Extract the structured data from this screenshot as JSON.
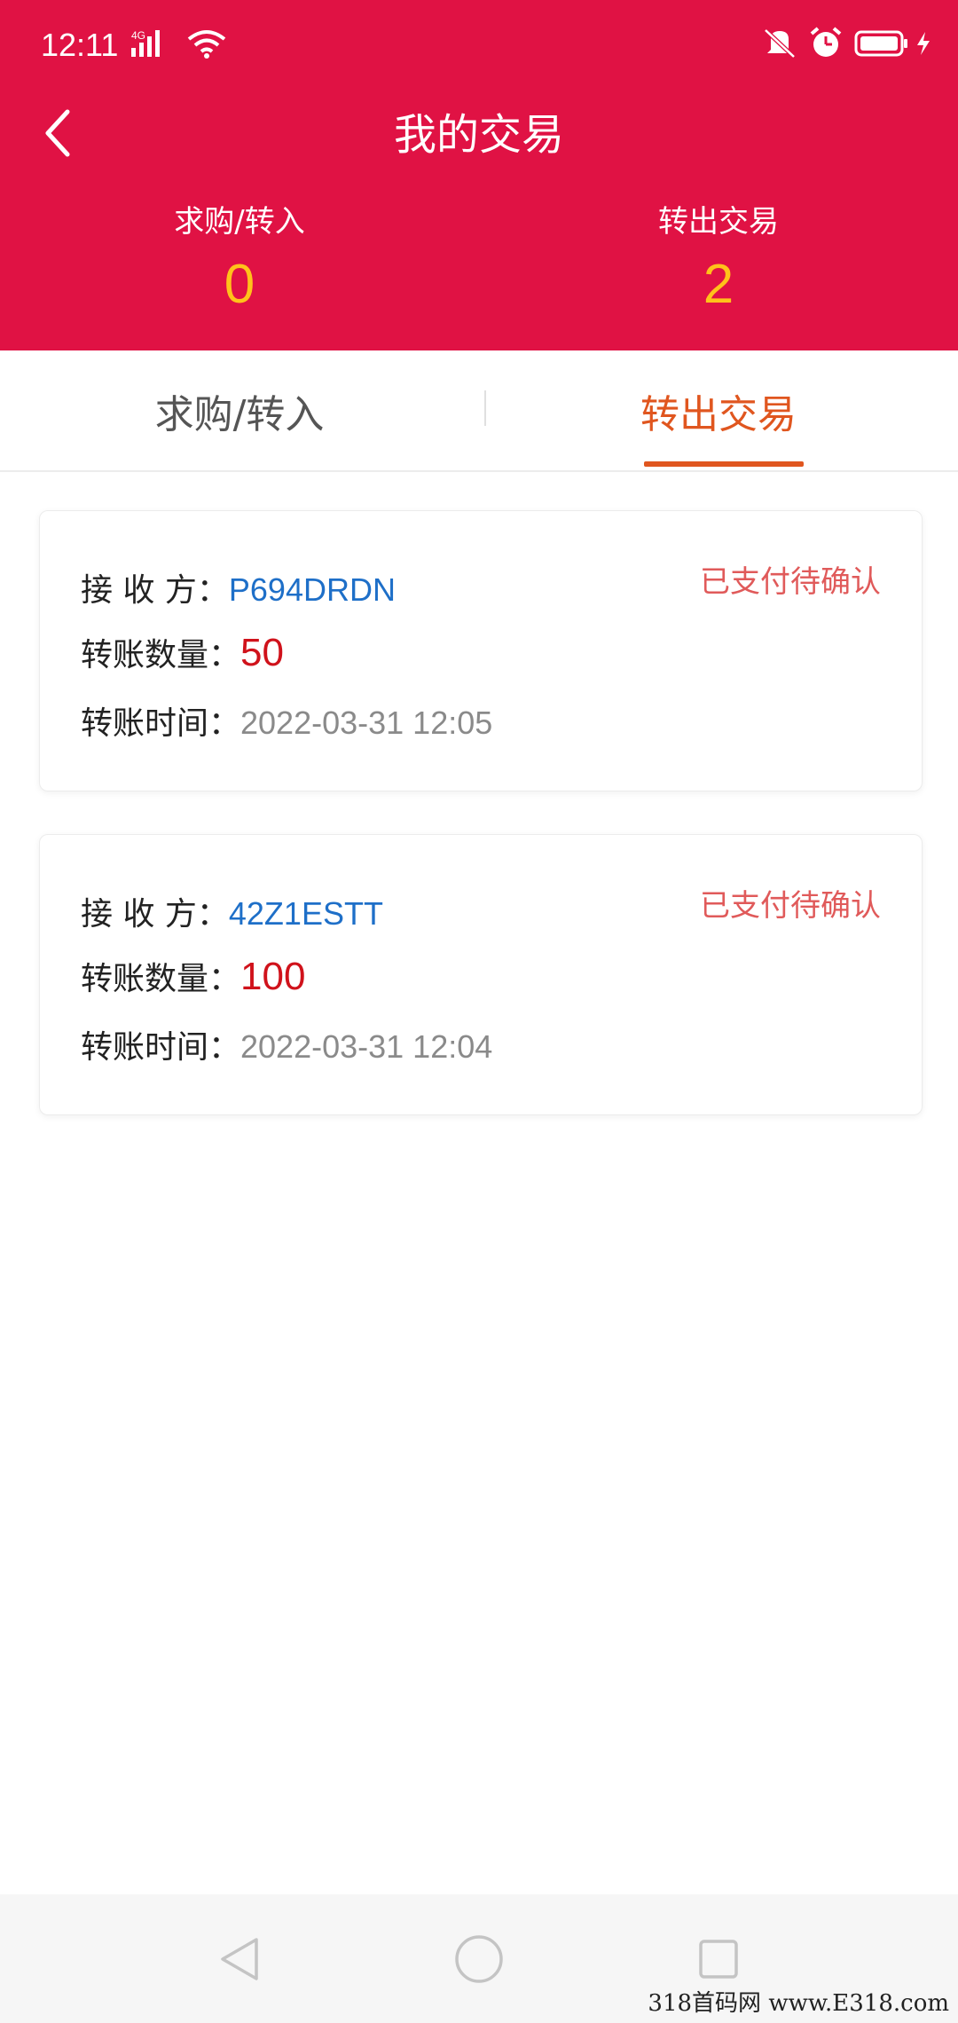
{
  "status_bar": {
    "time": "12:11",
    "network": "4G",
    "icons": [
      "signal-icon",
      "wifi-icon",
      "mute-icon",
      "alarm-icon",
      "battery-icon",
      "charging-icon"
    ]
  },
  "header": {
    "title": "我的交易",
    "back_icon": "back-arrow-icon",
    "background": "#e01244",
    "summary": [
      {
        "label": "求购/转入",
        "count": "0"
      },
      {
        "label": "转出交易",
        "count": "2"
      }
    ]
  },
  "tabs": {
    "items": [
      {
        "label": "求购/转入",
        "active": false
      },
      {
        "label": "转出交易",
        "active": true
      }
    ],
    "active_color": "#e0561f"
  },
  "records": [
    {
      "receiver_label": "接 收 方：",
      "receiver": "P694DRDN",
      "amount_label": "转账数量：",
      "amount": "50",
      "time_label": "转账时间：",
      "time": "2022-03-31 12:05",
      "status": "已支付待确认"
    },
    {
      "receiver_label": "接 收 方：",
      "receiver": "42Z1ESTT",
      "amount_label": "转账数量：",
      "amount": "100",
      "time_label": "转账时间：",
      "time": "2022-03-31 12:04",
      "status": "已支付待确认"
    }
  ],
  "bottom_nav": {
    "icons": [
      "nav-back-icon",
      "nav-home-icon",
      "nav-recents-icon"
    ]
  },
  "watermark": "318首码网 www.E318.com"
}
